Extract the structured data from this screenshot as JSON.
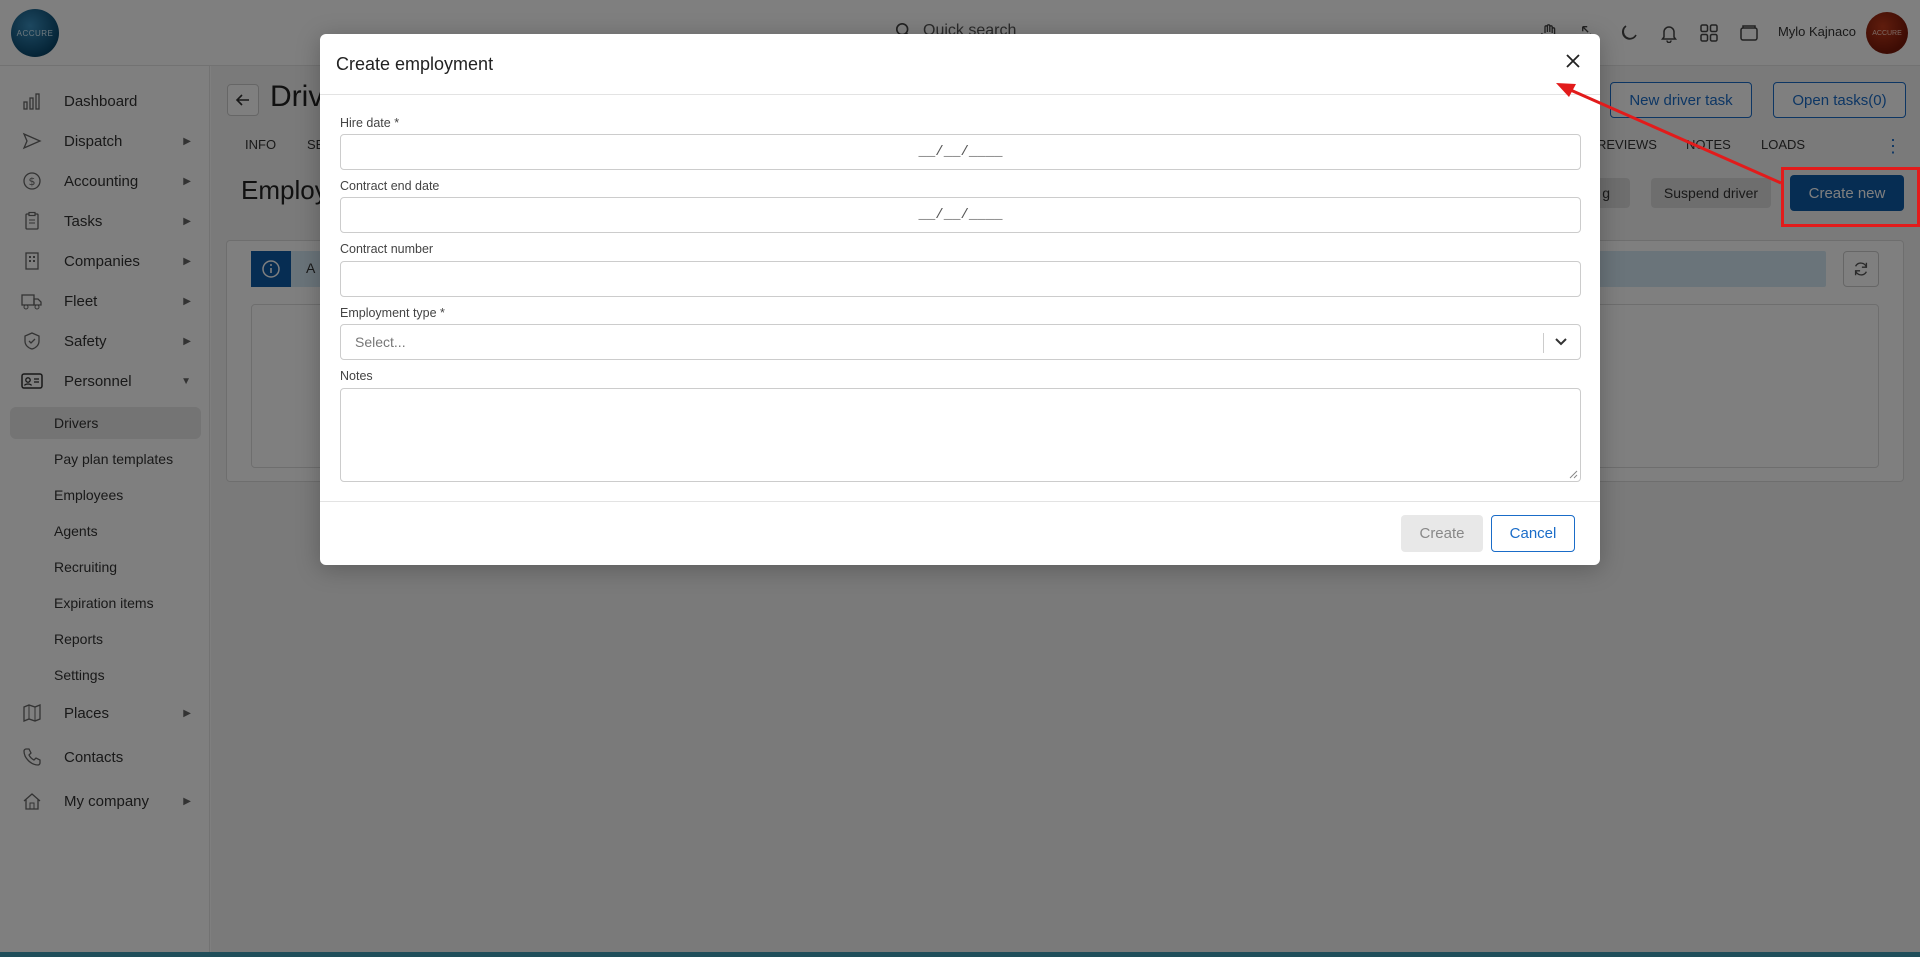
{
  "app": {
    "logo_text": "ACCURE",
    "search_placeholder": "Quick search",
    "user_name": "Mylo Kajnaco",
    "avatar_text": "ACCURE"
  },
  "top_icons": [
    "hand-icon",
    "expand-icon",
    "moon-icon",
    "bell-icon",
    "grid-icon",
    "wallet-icon"
  ],
  "sidebar": {
    "items": [
      {
        "label": "Dashboard",
        "icon": "chart-icon",
        "arrow": ""
      },
      {
        "label": "Dispatch",
        "icon": "send-icon",
        "arrow": "▶"
      },
      {
        "label": "Accounting",
        "icon": "dollar-icon",
        "arrow": "▶"
      },
      {
        "label": "Tasks",
        "icon": "clipboard-icon",
        "arrow": "▶"
      },
      {
        "label": "Companies",
        "icon": "building-icon",
        "arrow": "▶"
      },
      {
        "label": "Fleet",
        "icon": "truck-icon",
        "arrow": "▶"
      },
      {
        "label": "Safety",
        "icon": "shield-icon",
        "arrow": "▶"
      },
      {
        "label": "Personnel",
        "icon": "id-card-icon",
        "arrow": "▼"
      }
    ],
    "sub_items": [
      "Drivers",
      "Pay plan templates",
      "Employees",
      "Agents",
      "Recruiting",
      "Expiration items",
      "Reports",
      "Settings"
    ],
    "bottom_items": [
      {
        "label": "Places",
        "icon": "map-icon",
        "arrow": "▶"
      },
      {
        "label": "Contacts",
        "icon": "phone-icon",
        "arrow": ""
      },
      {
        "label": "My company",
        "icon": "home-icon",
        "arrow": "▶"
      }
    ]
  },
  "page": {
    "title": "Driv",
    "new_driver_task": "New driver task",
    "open_tasks": "Open tasks(0)",
    "tabs_left": [
      "INFO",
      "SE"
    ],
    "tabs_right": [
      "REVIEWS",
      "NOTES",
      "LOADS"
    ],
    "section_title": "Employ",
    "partial_btn": "g",
    "suspend_driver": "Suspend driver",
    "create_new": "Create new",
    "info_text": "A"
  },
  "modal": {
    "title": "Create employment",
    "fields": {
      "hire_date_label": "Hire date *",
      "hire_date_value": "__/__/____",
      "contract_end_label": "Contract end date",
      "contract_end_value": "__/__/____",
      "contract_number_label": "Contract number",
      "contract_number_value": "",
      "employment_type_label": "Employment type *",
      "employment_type_placeholder": "Select...",
      "notes_label": "Notes",
      "notes_value": ""
    },
    "create_label": "Create",
    "cancel_label": "Cancel"
  },
  "colors": {
    "primary": "#0d5aa7",
    "annotation": "#e21b1b",
    "overlay": "rgba(0,0,0,0.5)"
  }
}
